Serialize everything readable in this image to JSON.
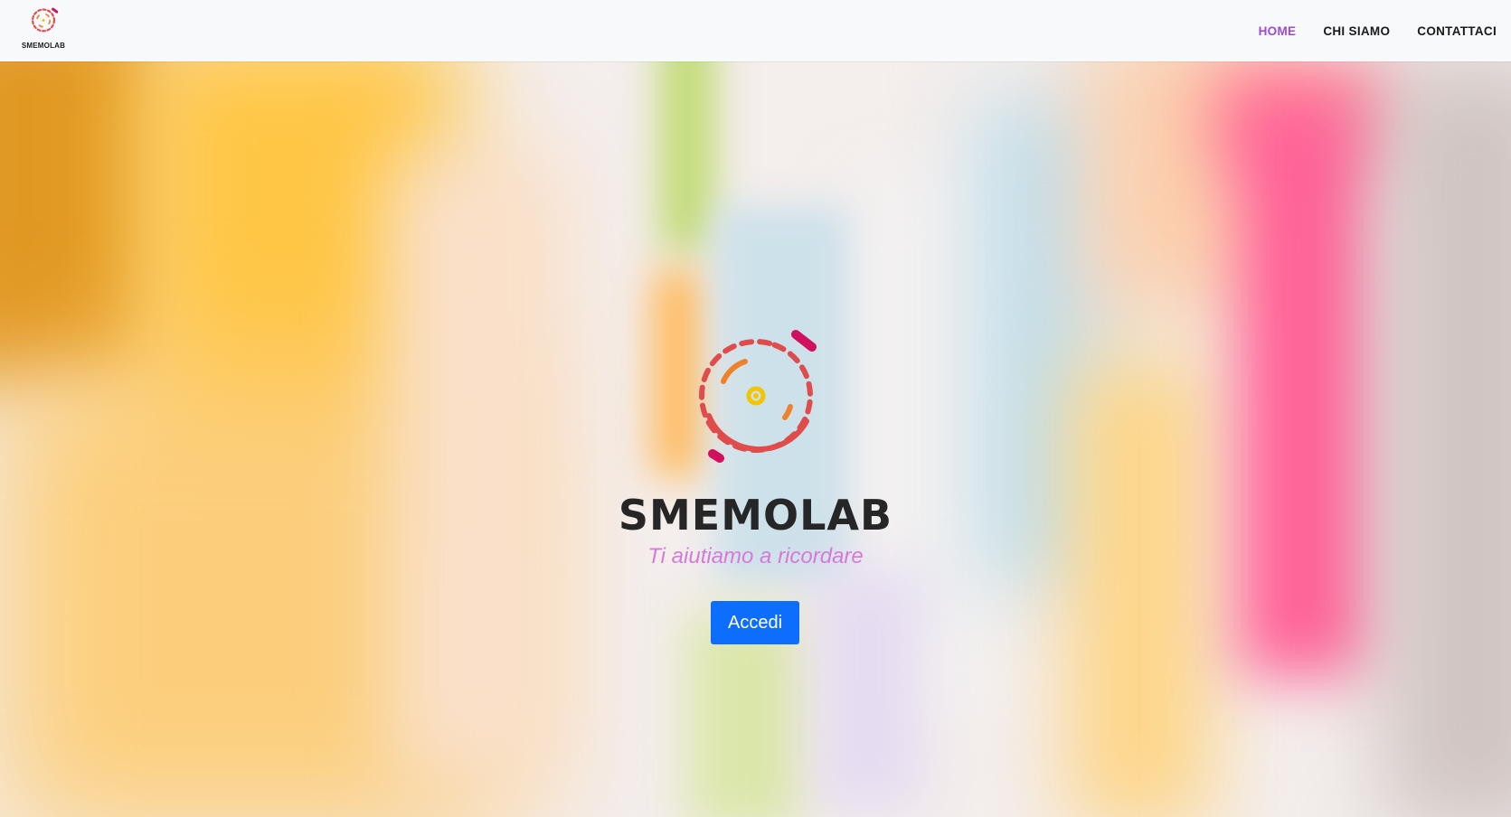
{
  "navbar": {
    "brand_label": "SMEMOLAB",
    "links": [
      {
        "label": "HOME",
        "active": true
      },
      {
        "label": "CHI SIAMO",
        "active": false
      },
      {
        "label": "CONTATTACI",
        "active": false
      }
    ]
  },
  "hero": {
    "title": "SMEMOLAB",
    "subtitle": "Ti aiutiamo a ricordare",
    "button_label": "Accedi"
  },
  "colors": {
    "nav_active": "#9b4bd8",
    "subtitle": "#d57ad8",
    "button_bg": "#0d6efd",
    "logo_red": "#e04b4b",
    "logo_magenta": "#d1115f",
    "logo_orange": "#f0812a",
    "logo_yellow": "#f2c500"
  },
  "icons": {
    "brand": "smemolab-logo-icon",
    "hero": "smemolab-logo-icon"
  }
}
